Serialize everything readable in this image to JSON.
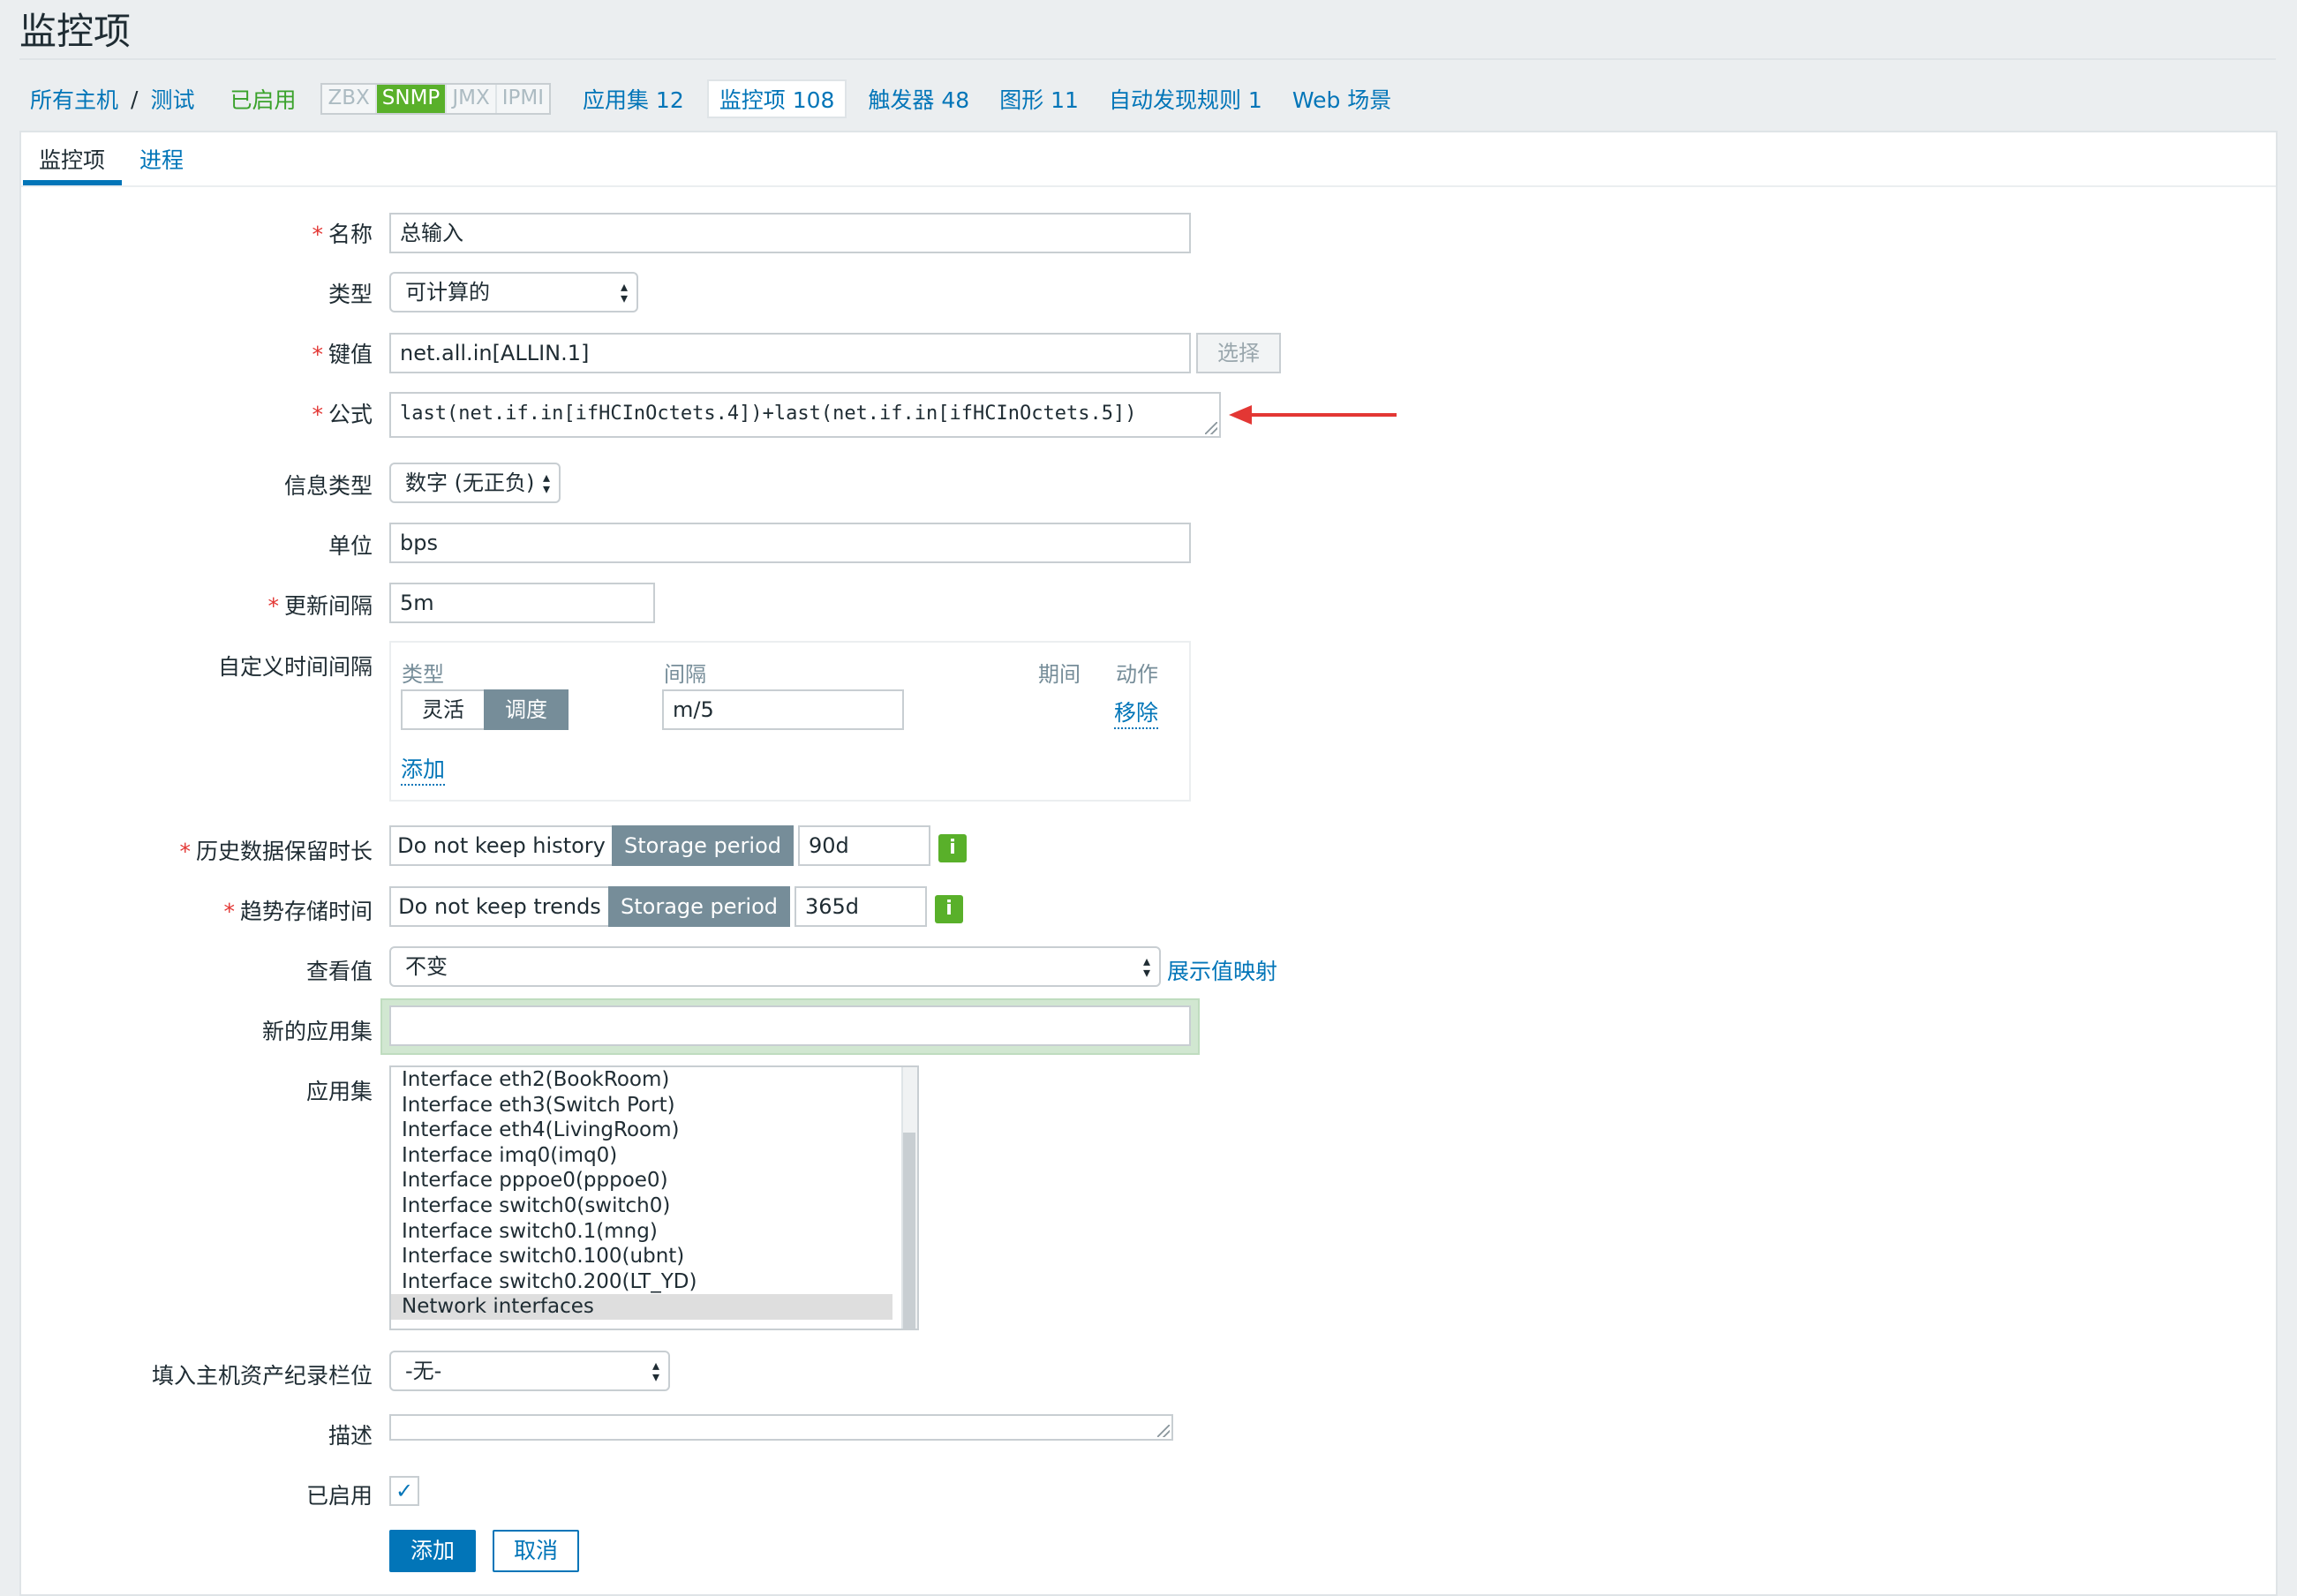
{
  "page": {
    "title": "监控项"
  },
  "breadcrumbs": {
    "all_hosts": "所有主机",
    "separator": "/",
    "host": "测试",
    "status": "已启用",
    "protocols": [
      "ZBX",
      "SNMP",
      "JMX",
      "IPMI"
    ],
    "active_protocol": "SNMP"
  },
  "host_nav": [
    {
      "label": "应用集 12",
      "active": false
    },
    {
      "label": "监控项 108",
      "active": true
    },
    {
      "label": "触发器 48",
      "active": false
    },
    {
      "label": "图形 11",
      "active": false
    },
    {
      "label": "自动发现规则 1",
      "active": false
    },
    {
      "label": "Web 场景",
      "active": false
    }
  ],
  "tabs": [
    {
      "label": "监控项",
      "active": true
    },
    {
      "label": "进程",
      "active": false
    }
  ],
  "form": {
    "name": {
      "label": "名称",
      "required": true,
      "value": "总输入"
    },
    "type": {
      "label": "类型",
      "value": "可计算的"
    },
    "key": {
      "label": "键值",
      "required": true,
      "value": "net.all.in[ALLIN.1]",
      "button": "选择"
    },
    "formula": {
      "label": "公式",
      "required": true,
      "value": "last(net.if.in[ifHCInOctets.4])+last(net.if.in[ifHCInOctets.5])"
    },
    "value_type": {
      "label": "信息类型",
      "value": "数字 (无正负)"
    },
    "units": {
      "label": "单位",
      "value": "bps"
    },
    "update_interval": {
      "label": "更新间隔",
      "required": true,
      "value": "5m"
    },
    "custom_intervals": {
      "label": "自定义时间间隔",
      "headers": {
        "type": "类型",
        "interval": "间隔",
        "period": "期间",
        "action": "动作"
      },
      "row": {
        "type_options": [
          "灵活",
          "调度"
        ],
        "active_type": "调度",
        "interval": "m/5",
        "remove": "移除"
      },
      "add": "添加"
    },
    "history": {
      "label": "历史数据保留时长",
      "required": true,
      "options": [
        "Do not keep history",
        "Storage period"
      ],
      "active": "Storage period",
      "value": "90d",
      "info": "i"
    },
    "trends": {
      "label": "趋势存储时间",
      "required": true,
      "options": [
        "Do not keep trends",
        "Storage period"
      ],
      "active": "Storage period",
      "value": "365d",
      "info": "i"
    },
    "show_value": {
      "label": "查看值",
      "value": "不变",
      "link": "展示值映射"
    },
    "new_application": {
      "label": "新的应用集",
      "value": ""
    },
    "applications": {
      "label": "应用集",
      "items": [
        "Interface eth2(BookRoom)",
        "Interface eth3(Switch Port)",
        "Interface eth4(LivingRoom)",
        "Interface imq0(imq0)",
        "Interface pppoe0(pppoe0)",
        "Interface switch0(switch0)",
        "Interface switch0.1(mng)",
        "Interface switch0.100(ubnt)",
        "Interface switch0.200(LT_YD)",
        "Network interfaces"
      ],
      "selected": "Network interfaces"
    },
    "inventory": {
      "label": "填入主机资产纪录栏位",
      "value": "-无-"
    },
    "description": {
      "label": "描述",
      "value": ""
    },
    "enabled": {
      "label": "已启用",
      "checked": true
    },
    "buttons": {
      "add": "添加",
      "cancel": "取消"
    }
  },
  "colors": {
    "link": "#0275b8",
    "enabled": "#3aa22b",
    "required": "#e33734",
    "toggle_active": "#768d99",
    "annotation_arrow": "#e33734"
  }
}
